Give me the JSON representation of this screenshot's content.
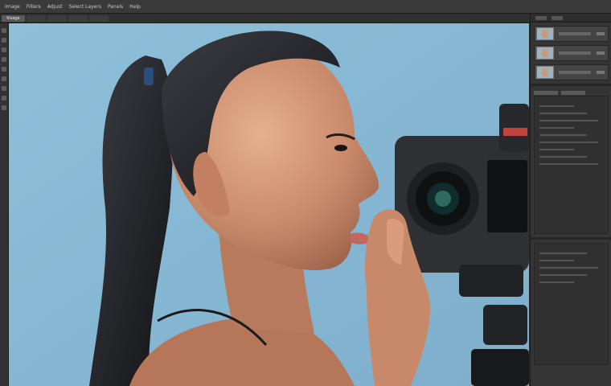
{
  "menu": {
    "items": [
      "Image",
      "Filters",
      "Adjust",
      "Select Layers",
      "Panels",
      "Help"
    ]
  },
  "tabs": [
    {
      "label": "Visage",
      "active": true
    },
    {
      "label": "",
      "active": false
    },
    {
      "label": "",
      "active": false
    },
    {
      "label": "",
      "active": false
    },
    {
      "label": "",
      "active": false
    }
  ],
  "panel": {
    "layer_count": 3
  },
  "colors": {
    "backdrop": "#8dbcd6",
    "chrome": "#2b2b2b",
    "panel": "#353535"
  },
  "icons": [
    "layer-thumbnail-icon",
    "visibility-eye-icon",
    "tool-icon"
  ]
}
